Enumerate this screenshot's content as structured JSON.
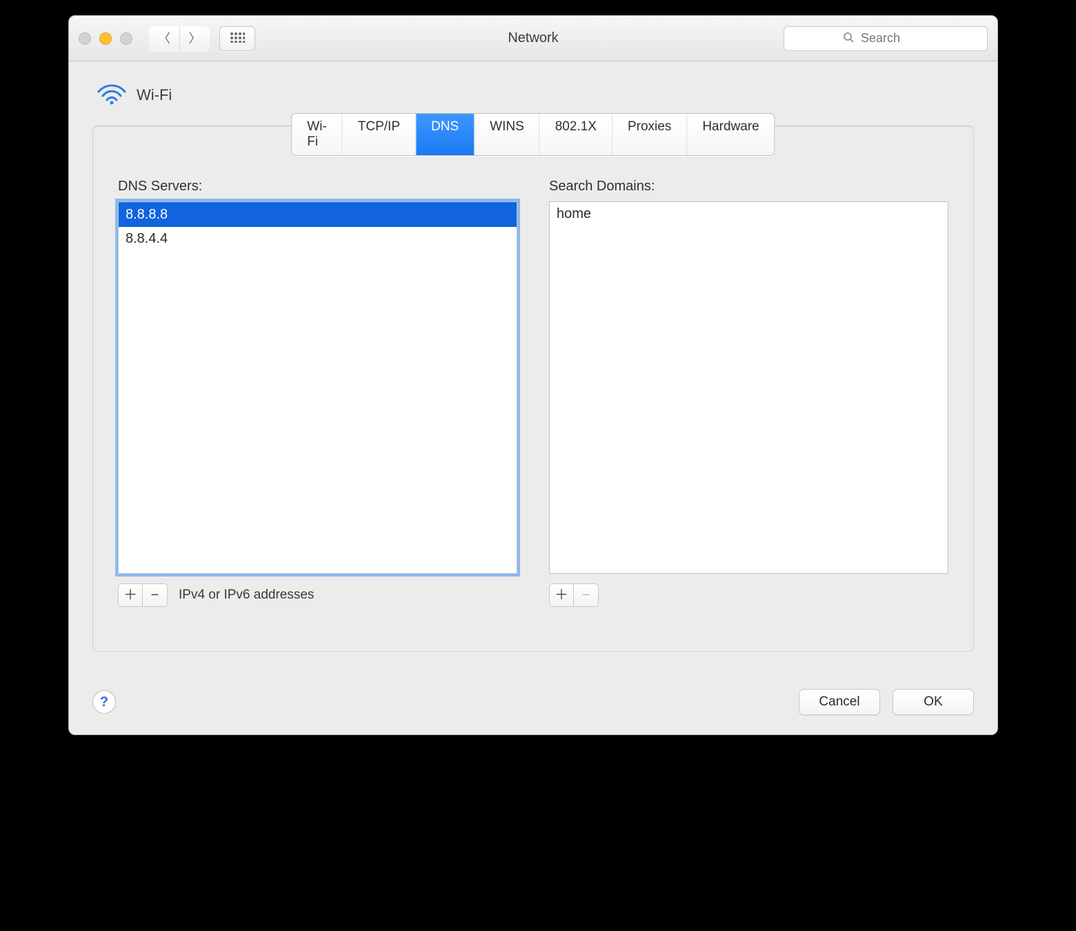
{
  "window": {
    "title": "Network",
    "search_placeholder": "Search"
  },
  "header": {
    "connection_name": "Wi-Fi"
  },
  "tabs": [
    {
      "id": "wifi",
      "label": "Wi-Fi",
      "active": false
    },
    {
      "id": "tcpip",
      "label": "TCP/IP",
      "active": false
    },
    {
      "id": "dns",
      "label": "DNS",
      "active": true
    },
    {
      "id": "wins",
      "label": "WINS",
      "active": false
    },
    {
      "id": "8021x",
      "label": "802.1X",
      "active": false
    },
    {
      "id": "proxies",
      "label": "Proxies",
      "active": false
    },
    {
      "id": "hardware",
      "label": "Hardware",
      "active": false
    }
  ],
  "dns": {
    "label": "DNS Servers:",
    "servers": [
      {
        "value": "8.8.8.8",
        "selected": true
      },
      {
        "value": "8.8.4.4",
        "selected": false
      }
    ],
    "help_text": "IPv4 or IPv6 addresses",
    "focused": true
  },
  "search_domains": {
    "label": "Search Domains:",
    "domains": [
      {
        "value": "home",
        "selected": false
      }
    ],
    "focused": false,
    "remove_disabled": true
  },
  "buttons": {
    "cancel": "Cancel",
    "ok": "OK"
  },
  "glyphs": {
    "plus": "＋",
    "minus": "−"
  },
  "colors": {
    "accent": "#1a7af3",
    "selection": "#1163de"
  }
}
